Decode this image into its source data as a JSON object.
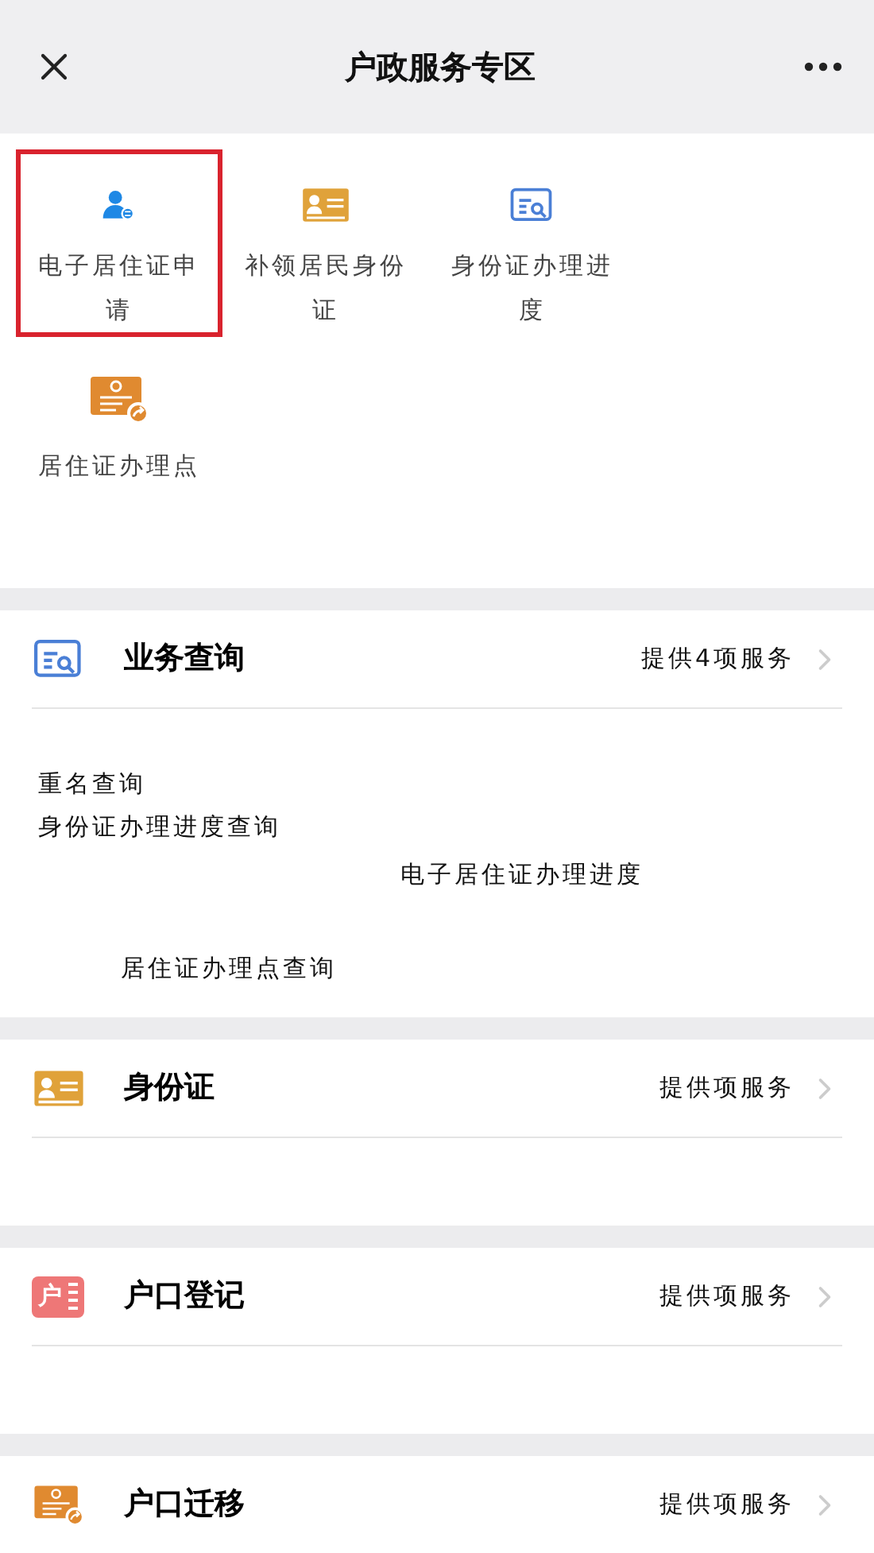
{
  "header": {
    "title": "户政服务专区"
  },
  "shortcuts": [
    {
      "label": "电子居住证申请",
      "kind": "person",
      "selected": true
    },
    {
      "label": "补领居民身份证",
      "kind": "id-card",
      "selected": false
    },
    {
      "label": "身份证办理进度",
      "kind": "search-doc",
      "selected": false
    },
    {
      "label": "居住证办理点",
      "kind": "card-share",
      "selected": false
    }
  ],
  "sections": [
    {
      "title": "业务查询",
      "kind": "search-doc",
      "summary": "提供4项服务",
      "items": [
        "重名查询",
        "身份证办理进度查询",
        "电子居住证办理进度",
        "居住证办理点查询"
      ]
    },
    {
      "title": "身份证",
      "kind": "id-card",
      "summary": "提供项服务"
    },
    {
      "title": "户口登记",
      "kind": "hukou",
      "icon_text": "户",
      "summary": "提供项服务"
    },
    {
      "title": "户口迁移",
      "kind": "card-share",
      "summary": "提供项服务"
    }
  ]
}
